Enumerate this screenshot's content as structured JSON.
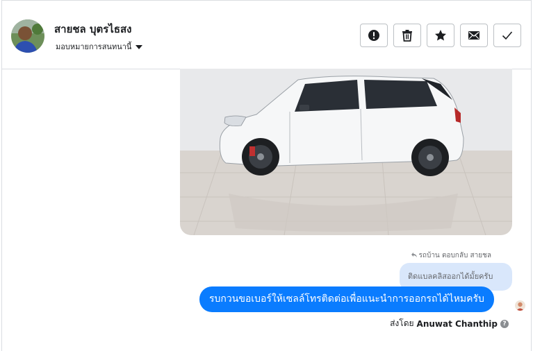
{
  "header": {
    "contact_name": "สายชล บุตรไธสง",
    "assign_label": "มอบหมายการสนทนานี้",
    "actions": [
      {
        "name": "report-button",
        "icon": "exclamation-icon"
      },
      {
        "name": "delete-button",
        "icon": "trash-icon"
      },
      {
        "name": "star-button",
        "icon": "star-icon"
      },
      {
        "name": "mark-unread-button",
        "icon": "envelope-icon"
      },
      {
        "name": "mark-done-button",
        "icon": "check-icon"
      }
    ]
  },
  "conversation": {
    "reply_meta": "รถบ้าน ตอบกลับ สายชล",
    "quoted_message": "ติดแบลคลิสออกได้มั้ยครับ",
    "message": "รบกวนขอเบอร์ให้เซลล์โทรติดต่อเพื่อแนะนำการออกรถได้ไหมครับ",
    "sent_by_prefix": "ส่งโดย",
    "sent_by_name": "Anuwat Chanthip"
  },
  "colors": {
    "message_bubble": "#0a7cff",
    "quoted_bubble": "#d9e7fb",
    "border": "#dadde1"
  }
}
